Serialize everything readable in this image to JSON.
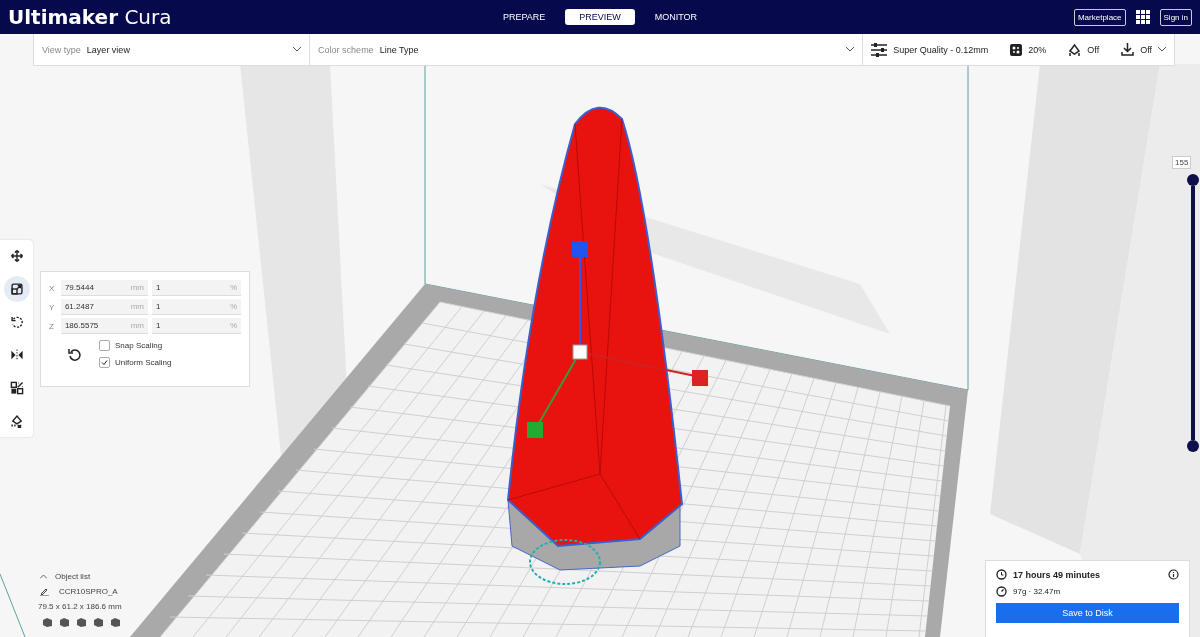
{
  "header": {
    "brand": "Ultimaker",
    "product": "Cura",
    "stages": [
      {
        "label": "PREPARE",
        "selected": false
      },
      {
        "label": "PREVIEW",
        "selected": true
      },
      {
        "label": "MONITOR",
        "selected": false
      }
    ],
    "marketplace": "Marketplace",
    "sign_in": "Sign in"
  },
  "toolbar": {
    "view_type": {
      "label": "View type",
      "value": "Layer view"
    },
    "color_scheme": {
      "label": "Color scheme",
      "value": "Line Type"
    },
    "profile": "Super Quality - 0.12mm",
    "infill": "20%",
    "support": "Off",
    "adhesion": "Off"
  },
  "tools": [
    {
      "kind": "move",
      "selected": false
    },
    {
      "kind": "scale",
      "selected": true
    },
    {
      "kind": "rotate",
      "selected": false
    },
    {
      "kind": "mirror",
      "selected": false
    },
    {
      "kind": "per-model",
      "selected": false
    },
    {
      "kind": "support-blocker",
      "selected": false
    }
  ],
  "scale_panel": {
    "rows": [
      {
        "axis": "X",
        "value": "79.5444",
        "unit": "mm",
        "percent": "1",
        "percent_unit": "%"
      },
      {
        "axis": "Y",
        "value": "61.2487",
        "unit": "mm",
        "percent": "1",
        "percent_unit": "%"
      },
      {
        "axis": "Z",
        "value": "186.5575",
        "unit": "mm",
        "percent": "1",
        "percent_unit": "%"
      }
    ],
    "options": [
      {
        "label": "Snap Scaling",
        "checked": false
      },
      {
        "label": "Uniform Scaling",
        "checked": true
      }
    ]
  },
  "layer_slider": {
    "label": "155",
    "level": 1
  },
  "object_list": {
    "title": "Object list",
    "expanded": true,
    "object": "CCR10SPRO_A",
    "dimensions": "79.5 x 61.2 x 186.6 mm"
  },
  "print_panel": {
    "time": "17 hours 49 minutes",
    "material": "97g · 32.47m",
    "button": "Save to Disk"
  }
}
